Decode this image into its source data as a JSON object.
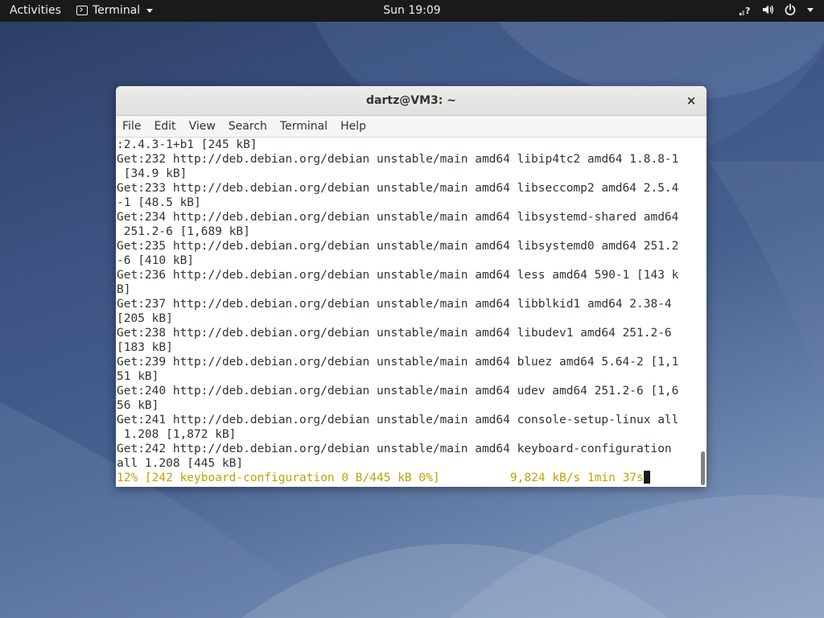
{
  "topbar": {
    "activities_label": "Activities",
    "app_menu_label": "Terminal",
    "app_menu_icon": "terminal-icon",
    "clock": "Sun 19:09",
    "status_icons": [
      "network-question-icon",
      "volume-icon",
      "power-icon",
      "chevron-down-icon"
    ]
  },
  "window": {
    "title": "dartz@VM3: ~",
    "close_icon": "close-icon",
    "close_glyph": "×",
    "menu": [
      "File",
      "Edit",
      "View",
      "Search",
      "Terminal",
      "Help"
    ]
  },
  "terminal": {
    "lines": [
      ":2.4.3-1+b1 [245 kB]",
      "Get:232 http://deb.debian.org/debian unstable/main amd64 libip4tc2 amd64 1.8.8-1",
      " [34.9 kB]",
      "Get:233 http://deb.debian.org/debian unstable/main amd64 libseccomp2 amd64 2.5.4",
      "-1 [48.5 kB]",
      "Get:234 http://deb.debian.org/debian unstable/main amd64 libsystemd-shared amd64",
      " 251.2-6 [1,689 kB]",
      "Get:235 http://deb.debian.org/debian unstable/main amd64 libsystemd0 amd64 251.2",
      "-6 [410 kB]",
      "Get:236 http://deb.debian.org/debian unstable/main amd64 less amd64 590-1 [143 k",
      "B]",
      "Get:237 http://deb.debian.org/debian unstable/main amd64 libblkid1 amd64 2.38-4",
      "[205 kB]",
      "Get:238 http://deb.debian.org/debian unstable/main amd64 libudev1 amd64 251.2-6",
      "[183 kB]",
      "Get:239 http://deb.debian.org/debian unstable/main amd64 bluez amd64 5.64-2 [1,1",
      "51 kB]",
      "Get:240 http://deb.debian.org/debian unstable/main amd64 udev amd64 251.2-6 [1,6",
      "56 kB]",
      "Get:241 http://deb.debian.org/debian unstable/main amd64 console-setup-linux all",
      " 1.208 [1,872 kB]",
      "Get:242 http://deb.debian.org/debian unstable/main amd64 keyboard-configuration",
      "all 1.208 [445 kB]"
    ],
    "progress_left": "12% [242 keyboard-configuration 0 B/445 kB 0%]",
    "progress_right": "9,824 kB/s 1min 37s",
    "progress_color": "#c4a000"
  }
}
